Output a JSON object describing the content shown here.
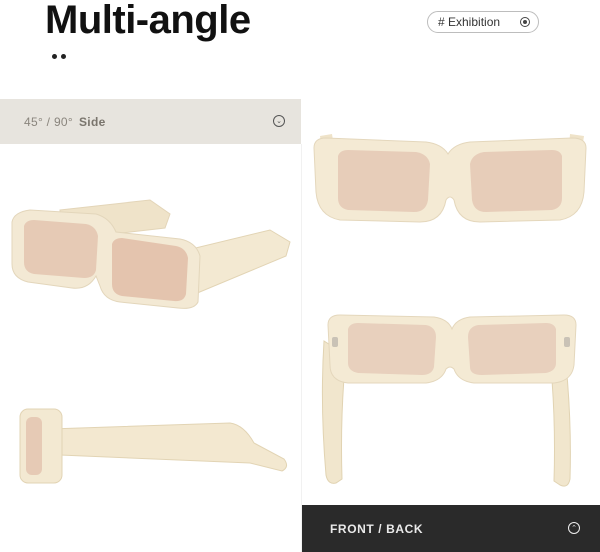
{
  "header": {
    "title": "Multi-angle",
    "exhibition_label": "# Exhibition"
  },
  "side_view": {
    "angles": "45° / 90°",
    "side_label": "Side"
  },
  "front_back_view": {
    "label": "FRONT / BACK"
  },
  "colors": {
    "frame": "#f2e8d2",
    "lens": "#e6cab4",
    "bar_light": "#e7e4de",
    "bar_dark": "#2a2a2a"
  }
}
